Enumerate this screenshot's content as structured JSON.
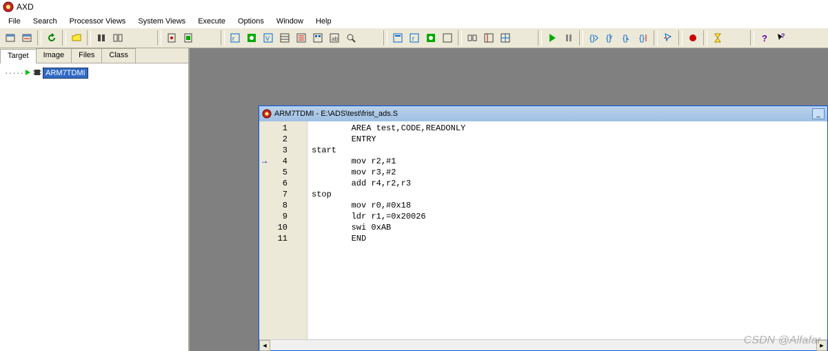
{
  "app": {
    "title": "AXD"
  },
  "menu": [
    "File",
    "Search",
    "Processor Views",
    "System Views",
    "Execute",
    "Options",
    "Window",
    "Help"
  ],
  "tabs": {
    "items": [
      "Target",
      "Image",
      "Files",
      "Class"
    ],
    "active": 0
  },
  "tree": {
    "selected": "ARM7TDMI"
  },
  "child_window": {
    "title": "ARM7TDMI - E:\\ADS\\test\\frist_ads.S",
    "current_line": 4,
    "lines": [
      {
        "n": 1,
        "text": "        AREA test,CODE,READONLY"
      },
      {
        "n": 2,
        "text": "        ENTRY"
      },
      {
        "n": 3,
        "text": "start"
      },
      {
        "n": 4,
        "text": "        mov r2,#1"
      },
      {
        "n": 5,
        "text": "        mov r3,#2"
      },
      {
        "n": 6,
        "text": "        add r4,r2,r3"
      },
      {
        "n": 7,
        "text": "stop"
      },
      {
        "n": 8,
        "text": "        mov r0,#0x18"
      },
      {
        "n": 9,
        "text": "        ldr r1,=0x20026"
      },
      {
        "n": 10,
        "text": "        swi 0xAB"
      },
      {
        "n": 11,
        "text": "        END"
      }
    ]
  },
  "watermark": "CSDN @Alfafar"
}
